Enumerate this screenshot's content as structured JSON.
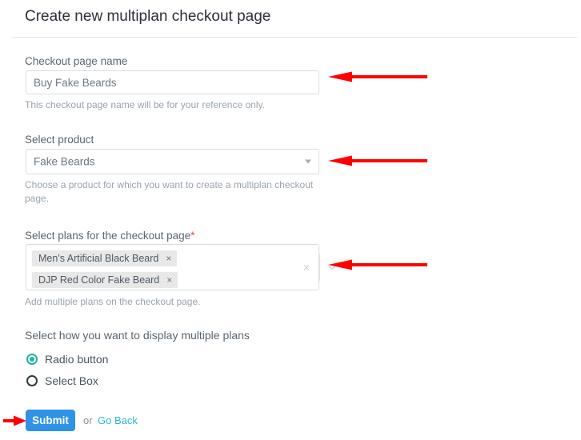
{
  "page": {
    "title": "Create new multiplan checkout page"
  },
  "form": {
    "checkout_name": {
      "label": "Checkout page name",
      "value": "Buy Fake Beards",
      "placeholder": "Checkout page name",
      "help": "This checkout page name will be for your reference only."
    },
    "product": {
      "label": "Select product",
      "value": "Fake Beards",
      "help": "Choose a product for which you want to create a multiplan checkout page."
    },
    "plans": {
      "label": "Select plans for the checkout page",
      "required_marker": "*",
      "tags": [
        {
          "label": "Men's Artificial Black Beard",
          "remove": "×"
        },
        {
          "label": "DJP Red Color Fake Beard",
          "remove": "×"
        }
      ],
      "clear_all": "×",
      "help": "Add multiple plans on the checkout page."
    },
    "display_mode": {
      "label": "Select how you want to display multiple plans",
      "options": [
        {
          "label": "Radio button",
          "selected": true
        },
        {
          "label": "Select Box",
          "selected": false
        }
      ]
    }
  },
  "footer": {
    "submit_label": "Submit",
    "or_text": "or",
    "goback_label": "Go Back"
  },
  "colors": {
    "accent_blue": "#2e92e6",
    "accent_teal": "#20b2a0",
    "link_teal": "#29b6d8",
    "required_red": "#e74c3c",
    "annotation_red": "#ff0000",
    "label_grey": "#5a6570",
    "help_grey": "#9aa3ae",
    "tag_grey": "#e8e8e8",
    "border_grey": "#d8dce0"
  }
}
